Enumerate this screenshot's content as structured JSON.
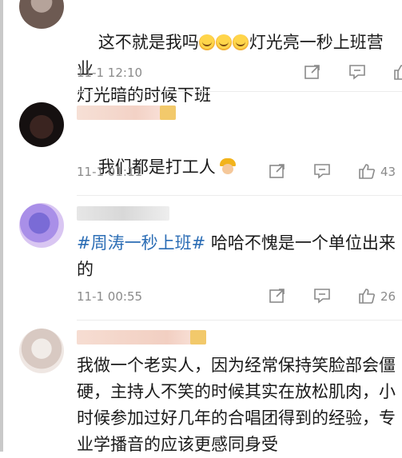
{
  "comments": [
    {
      "text_before": "这不就是我吗",
      "emoji_count": 3,
      "text_after": "灯光亮一秒上班营业\n灯光暗的时候下班",
      "time": "11-1 12:10",
      "likes": ""
    },
    {
      "text": "我们都是打工人",
      "emoji": "construction-worker",
      "time": "11-1 01:11",
      "likes": "43"
    },
    {
      "hashtag": "#周涛一秒上班#",
      "text": " 哈哈不愧是一个单位出来\n的",
      "time": "11-1 00:55",
      "likes": "26"
    },
    {
      "text": "我做一个老实人，因为经常保持笑脸部会僵\n硬，主持人不笑的时候其实在放松肌肉，小\n时候参加过好几年的合唱团得到的经验，专\n业学播音的应该更感同身受",
      "time": "",
      "likes": ""
    }
  ],
  "colors": {
    "hashtag": "#2b6db5",
    "meta": "#8a8a8a",
    "badge": "#f2c96b"
  },
  "icons": [
    "share-icon",
    "comment-icon",
    "like-icon"
  ]
}
